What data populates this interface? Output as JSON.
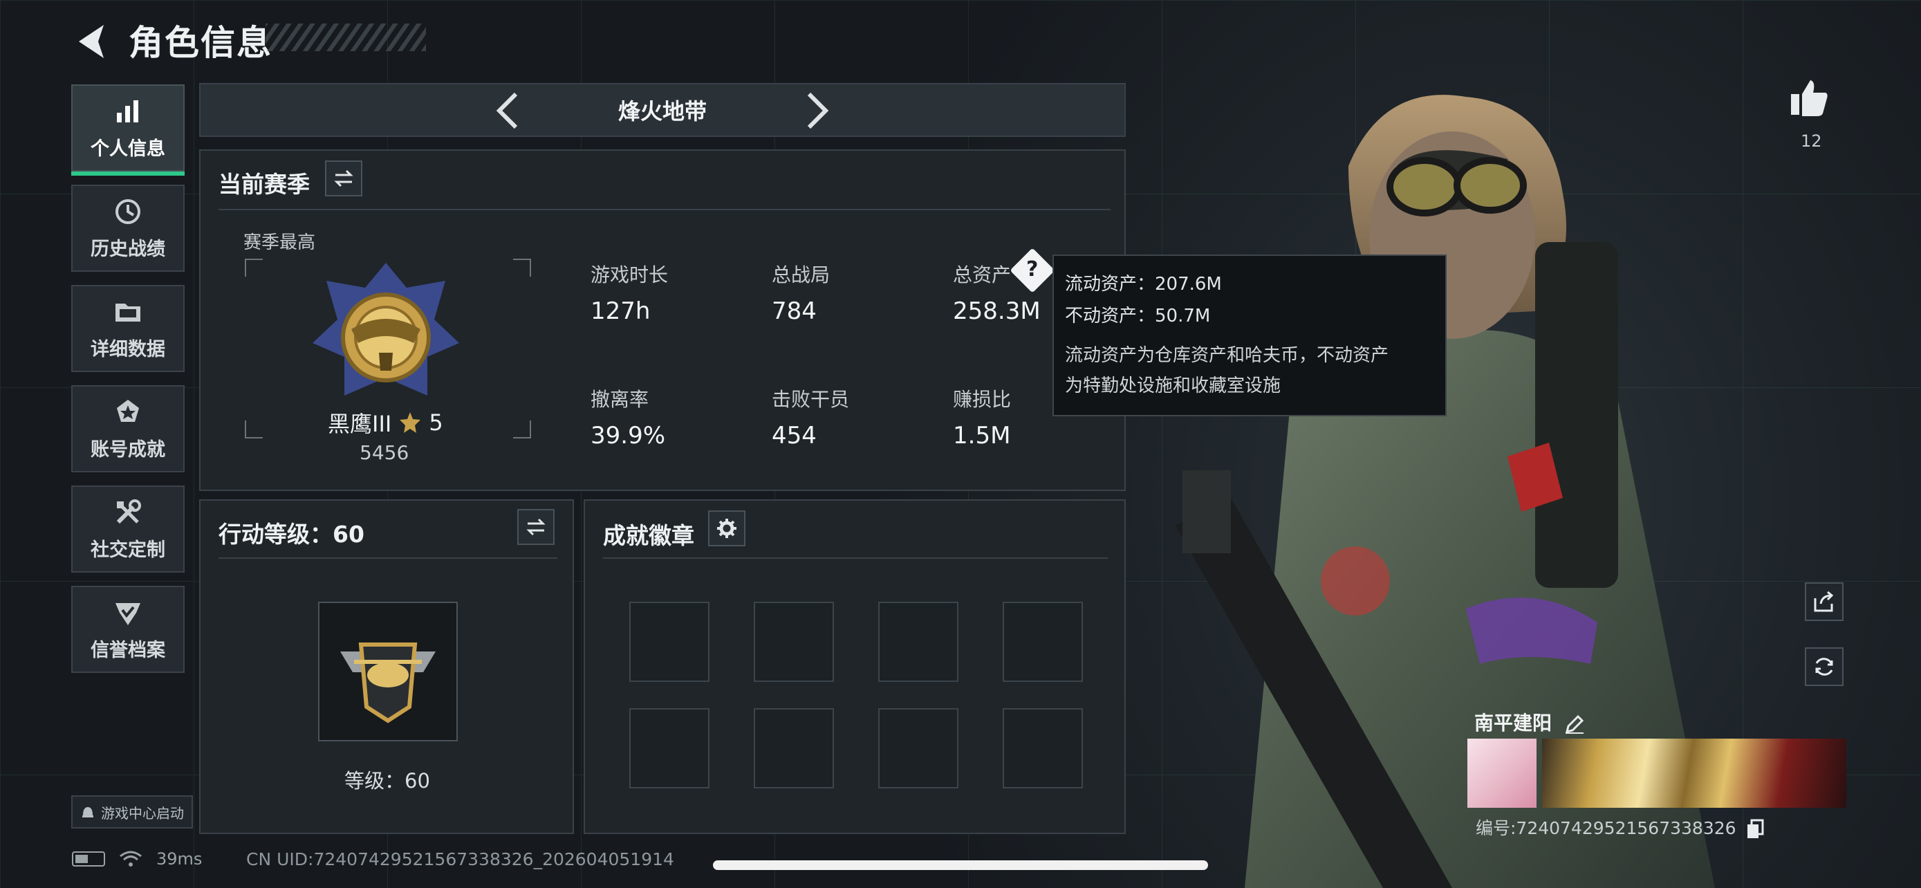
{
  "header": {
    "title": "角色信息"
  },
  "nav": [
    {
      "label": "个人信息",
      "icon": "bar-chart-icon",
      "active": true
    },
    {
      "label": "历史战绩",
      "icon": "history-clock-icon",
      "active": false
    },
    {
      "label": "详细数据",
      "icon": "folder-icon",
      "active": false
    },
    {
      "label": "账号成就",
      "icon": "medal-icon",
      "active": false
    },
    {
      "label": "社交定制",
      "icon": "tools-icon",
      "active": false
    },
    {
      "label": "信誉档案",
      "icon": "shield-check-icon",
      "active": false
    }
  ],
  "game_center": {
    "label": "游戏中心启动"
  },
  "status": {
    "ping": "39ms",
    "uid_line": "CN UID:7240742952156733832​6_202604051914"
  },
  "mode": {
    "title": "烽火地带"
  },
  "season": {
    "title": "当前赛季",
    "best_label": "赛季最高",
    "rank_name": "黑鹰III",
    "rank_stars": "5",
    "rank_points": "5456",
    "stats": [
      {
        "label": "游戏时长",
        "value": "127h"
      },
      {
        "label": "总战局",
        "value": "784"
      },
      {
        "label": "总资产",
        "value": "258.3M"
      },
      {
        "label": "撤离率",
        "value": "39.9%"
      },
      {
        "label": "击败干员",
        "value": "454"
      },
      {
        "label": "赚损比",
        "value": "1.5M"
      }
    ]
  },
  "tooltip": {
    "liquid": "流动资产：207.6M",
    "fixed": "不动资产：50.7M",
    "desc_line1": "流动资产为仓库资产和哈夫币，不动资产",
    "desc_line2": "为特勤处设施和收藏室设施"
  },
  "action_level": {
    "title": "行动等级：60",
    "level_label": "等级：60"
  },
  "achievements": {
    "title": "成就徽章"
  },
  "player": {
    "likes": "12",
    "name": "南平建阳",
    "id": "编号:7240742952156733832​6"
  },
  "colors": {
    "accent": "#2ec98a",
    "gold": "#c9a14a",
    "panel": "#1f2529"
  }
}
